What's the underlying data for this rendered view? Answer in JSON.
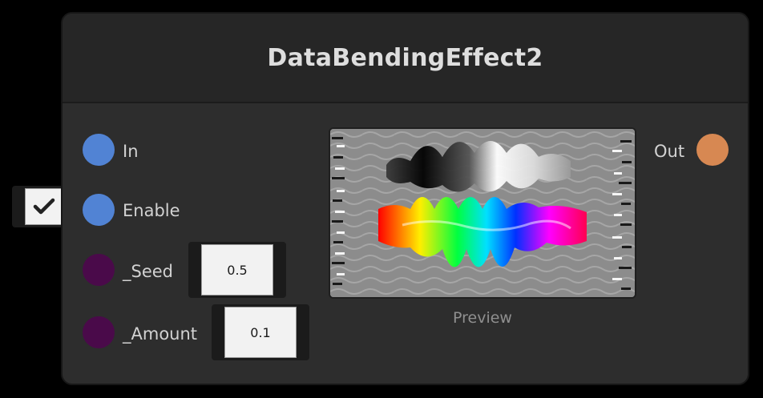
{
  "node": {
    "title": "DataBendingEffect2",
    "inputs": {
      "in_label": "In",
      "enable_label": "Enable",
      "seed_label": "_Seed",
      "seed_value": "0.5",
      "amount_label": "_Amount",
      "amount_value": "0.1"
    },
    "outputs": {
      "out_label": "Out"
    },
    "preview_label": "Preview",
    "enable_checked": true
  },
  "colors": {
    "texture_port": "#5183d4",
    "float_port": "#4a0a4a",
    "output_port": "#d78852",
    "node_body": "#2d2d2d",
    "node_header": "#262626"
  },
  "icons": {
    "checkbox": "checkmark-icon"
  }
}
